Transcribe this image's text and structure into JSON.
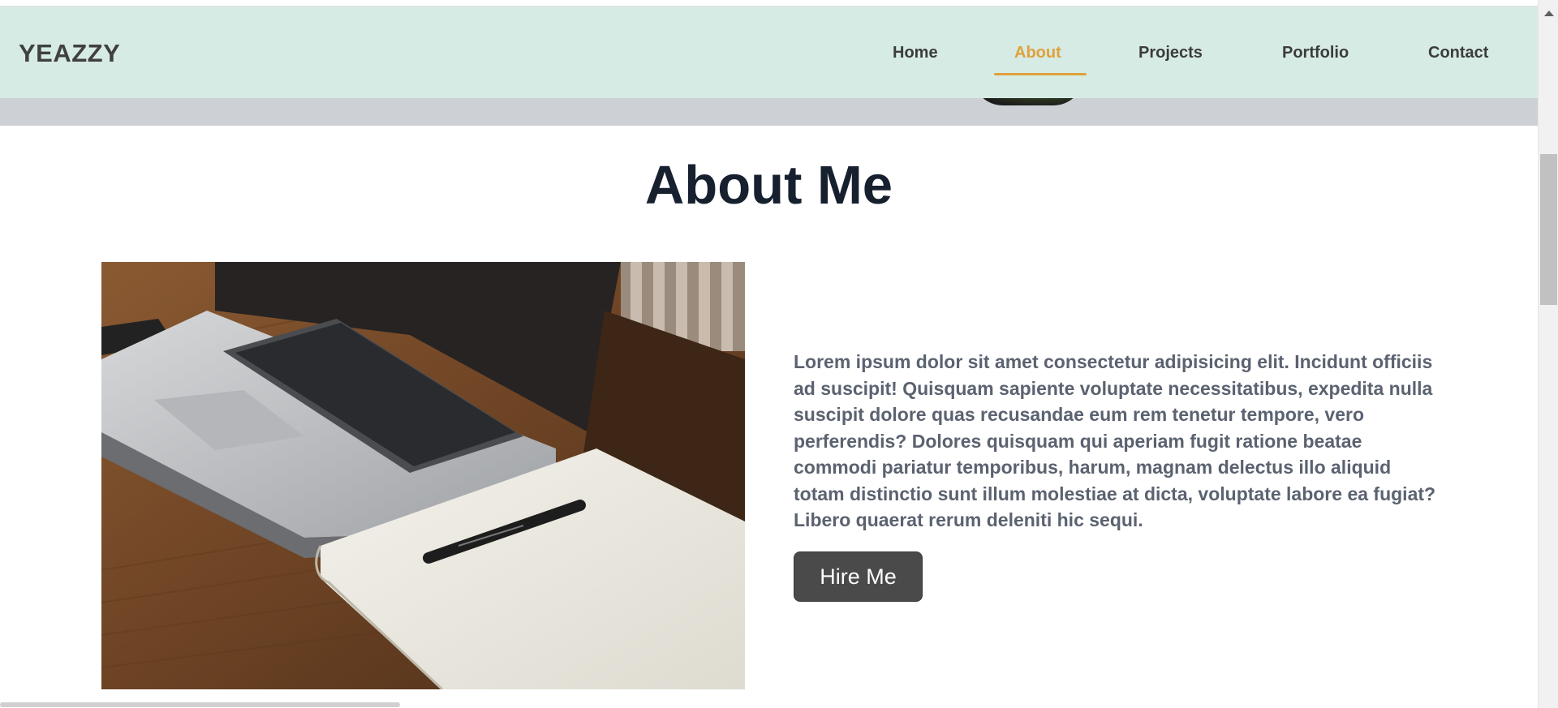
{
  "brand": {
    "logo": "YEAZZY"
  },
  "nav": {
    "items": [
      {
        "label": "Home"
      },
      {
        "label": "About",
        "active": true
      },
      {
        "label": "Projects"
      },
      {
        "label": "Portfolio"
      },
      {
        "label": "Contact"
      }
    ]
  },
  "about": {
    "title": "About Me",
    "paragraph": "Lorem ipsum dolor sit amet consectetur adipisicing elit. Incidunt officiis ad suscipit! Quisquam sapiente voluptate necessitatibus, expedita nulla suscipit dolore quas recusandae eum rem tenetur tempore, vero perferendis? Dolores quisquam qui aperiam fugit ratione beatae commodi pariatur temporibus, harum, magnam delectus illo aliquid totam distinctio sunt illum molestiae at dicta, voluptate labore ea fugiat? Libero quaerat rerum deleniti hic sequi.",
    "button_label": "Hire Me",
    "image_icon": "laptop-notebook-photo"
  },
  "colors": {
    "navbar_bg": "#d6ebe4",
    "accent": "#e0a139",
    "title": "#17202e",
    "body_text": "#5b6270",
    "button_bg": "#4a4a4a"
  }
}
